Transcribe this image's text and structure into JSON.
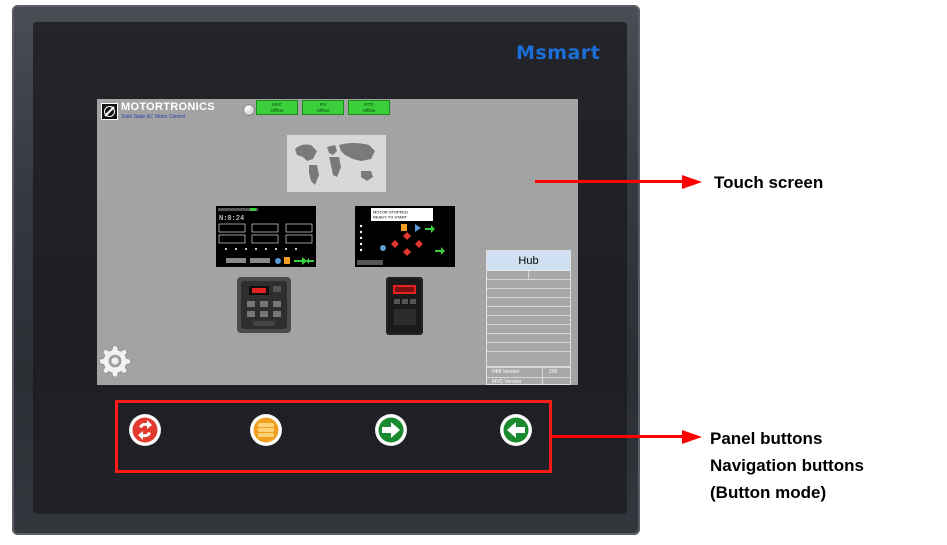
{
  "device": {
    "brand": "Msmart"
  },
  "screen": {
    "logo": {
      "name": "MOTORTRONICS",
      "tagline": "Solid State AC Motor Control"
    },
    "status": [
      {
        "label": "MVC",
        "state": "Offline"
      },
      {
        "label": "RX",
        "state": "Offline"
      },
      {
        "label": "RTD",
        "state": "Offline"
      }
    ],
    "monitor_readout": "N:0:24",
    "control_status": [
      "MOTOR STOPPED",
      "READY TO START"
    ],
    "hub": {
      "title": "Hub",
      "hmi_label": "HMI Version",
      "hmi_value": "200",
      "mvc_label": "MVC Version"
    }
  },
  "panel_buttons": [
    {
      "icon": "refresh-icon",
      "color": "#e23a2e"
    },
    {
      "icon": "menu-icon",
      "color": "#f0a020"
    },
    {
      "icon": "arrow-right-icon",
      "color": "#1a8a2e"
    },
    {
      "icon": "arrow-left-icon",
      "color": "#1a8a2e"
    }
  ],
  "annotations": {
    "touch_screen": "Touch screen",
    "panel_lines": [
      "Panel buttons",
      "Navigation buttons",
      "(Button mode)"
    ]
  },
  "colors": {
    "highlight": "#ff0000",
    "brand": "#1c6fd8",
    "screen_bg": "#a3a3a3"
  }
}
